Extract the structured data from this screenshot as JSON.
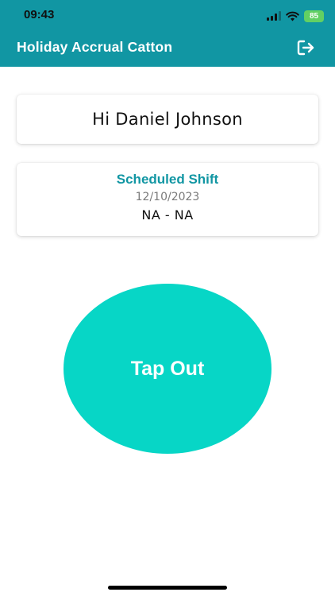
{
  "status_bar": {
    "time": "09:43",
    "battery": "85",
    "battery_color": "#62d063",
    "icons": [
      "signal-icon",
      "wifi-icon",
      "battery-icon"
    ]
  },
  "header": {
    "title": "Holiday Accrual Catton",
    "logout_icon": "logout-icon",
    "background": "#1196a3"
  },
  "greeting": {
    "text": "Hi Daniel Johnson"
  },
  "shift": {
    "title": "Scheduled Shift",
    "date": "12/10/2023",
    "time": "NA - NA"
  },
  "action": {
    "label": "Tap Out",
    "color": "#07d6c6"
  }
}
